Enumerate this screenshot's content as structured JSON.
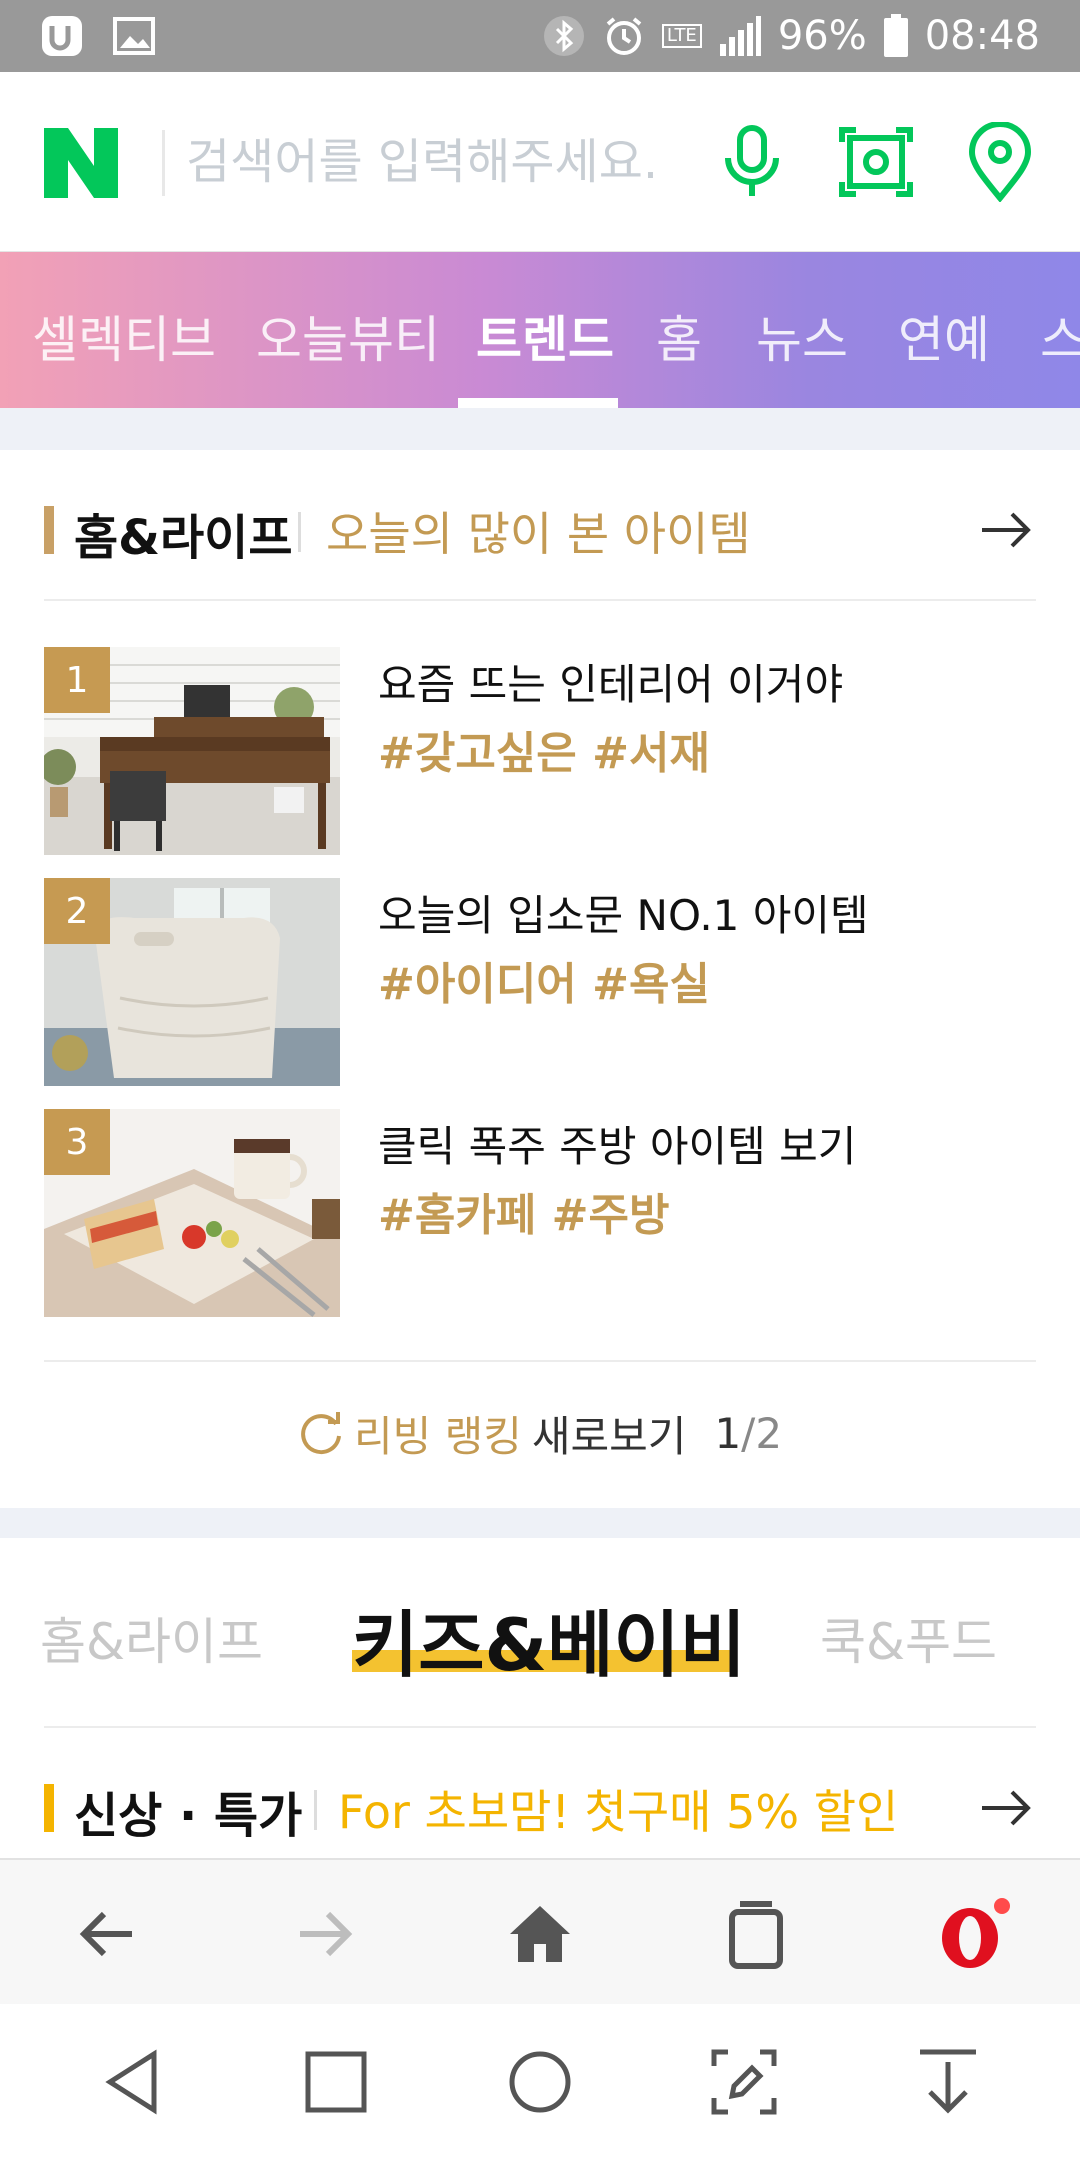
{
  "status_bar": {
    "battery": "96%",
    "time": "08:48",
    "network": "LTE",
    "icons": [
      "app-icon",
      "image-icon",
      "bluetooth-icon",
      "alarm-icon",
      "lte-icon",
      "signal-icon",
      "battery-icon"
    ]
  },
  "search": {
    "logo": "N",
    "placeholder": "검색어를 입력해주세요.",
    "icons": [
      "microphone-icon",
      "camera-lens-icon",
      "location-pin-icon"
    ],
    "brand_color": "#03c75a"
  },
  "tabs": [
    {
      "label": "셀렉티브",
      "active": false
    },
    {
      "label": "오늘뷰티",
      "active": false
    },
    {
      "label": "트렌드",
      "active": true
    },
    {
      "label": "홈",
      "active": false
    },
    {
      "label": "뉴스",
      "active": false
    },
    {
      "label": "연예",
      "active": false
    },
    {
      "label": "스",
      "active": false
    }
  ],
  "home_life": {
    "title": "홈&라이프",
    "subtitle": "오늘의 많이 본 아이템",
    "accent_color": "#c39a53",
    "items": [
      {
        "rank": "1",
        "title": "요즘 뜨는 인테리어 이거야",
        "tags": "#갖고싶은 #서재"
      },
      {
        "rank": "2",
        "title": "오늘의 입소문 NO.1 아이템",
        "tags": "#아이디어 #욕실"
      },
      {
        "rank": "3",
        "title": "클릭 폭주 주방 아이템 보기",
        "tags": "#홈카페 #주방"
      }
    ],
    "refresh": {
      "accent": "리빙 랭킹",
      "label": "새로보기",
      "page_current": "1",
      "page_total": "/2"
    }
  },
  "category_tabs": [
    {
      "label": "홈&라이프",
      "active": false
    },
    {
      "label": "키즈&베이비",
      "active": true
    },
    {
      "label": "쿡&푸드",
      "active": false
    }
  ],
  "new_items": {
    "title": "신상 · 특가",
    "subtitle": "For 초보맘! 첫구매 5% 할인",
    "accent_color": "#f4b400"
  },
  "browser_toolbar": {
    "icons": [
      "back-arrow-icon",
      "forward-arrow-icon",
      "home-icon",
      "tabs-icon",
      "opera-icon"
    ]
  },
  "nav_bar": {
    "icons": [
      "nav-back-icon",
      "nav-recents-icon",
      "nav-home-icon",
      "screenshot-edit-icon",
      "notification-pull-icon"
    ]
  }
}
